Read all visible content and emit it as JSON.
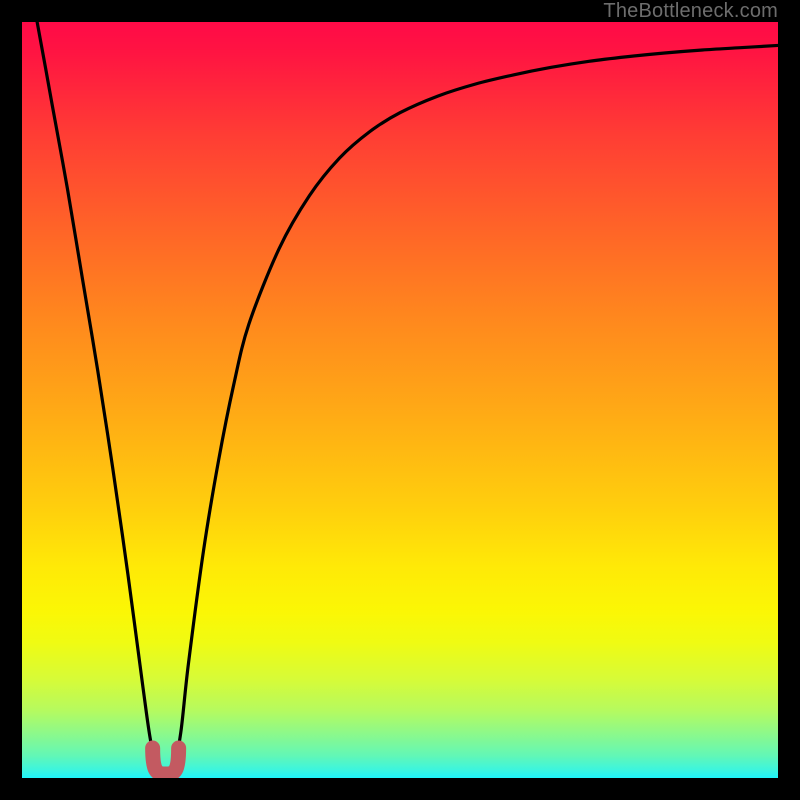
{
  "watermark": "TheBottleneck.com",
  "colors": {
    "gradient_top": "#ff0a47",
    "gradient_bottom": "#1ff4fa",
    "curve": "#000000",
    "valley_marker": "#c35a61",
    "frame": "#000000"
  },
  "chart_data": {
    "type": "line",
    "title": "",
    "xlabel": "",
    "ylabel": "",
    "xlim": [
      0,
      100
    ],
    "ylim": [
      0,
      100
    ],
    "x": [
      0,
      2,
      4,
      6,
      8,
      10,
      12,
      14,
      16,
      17,
      18,
      19,
      20,
      21,
      22,
      24,
      26,
      28,
      30,
      34,
      38,
      42,
      46,
      50,
      55,
      60,
      65,
      70,
      75,
      80,
      85,
      90,
      95,
      100
    ],
    "values": [
      110,
      100,
      89,
      78,
      66,
      54,
      41,
      27,
      12,
      5,
      1,
      0,
      1,
      6,
      15,
      30,
      42,
      52,
      60,
      70,
      77,
      82,
      85.5,
      88,
      90.2,
      91.8,
      93,
      94,
      94.8,
      95.4,
      95.9,
      96.3,
      96.6,
      96.9
    ],
    "valley_x": 19,
    "valley_y": 0,
    "annotations": []
  }
}
